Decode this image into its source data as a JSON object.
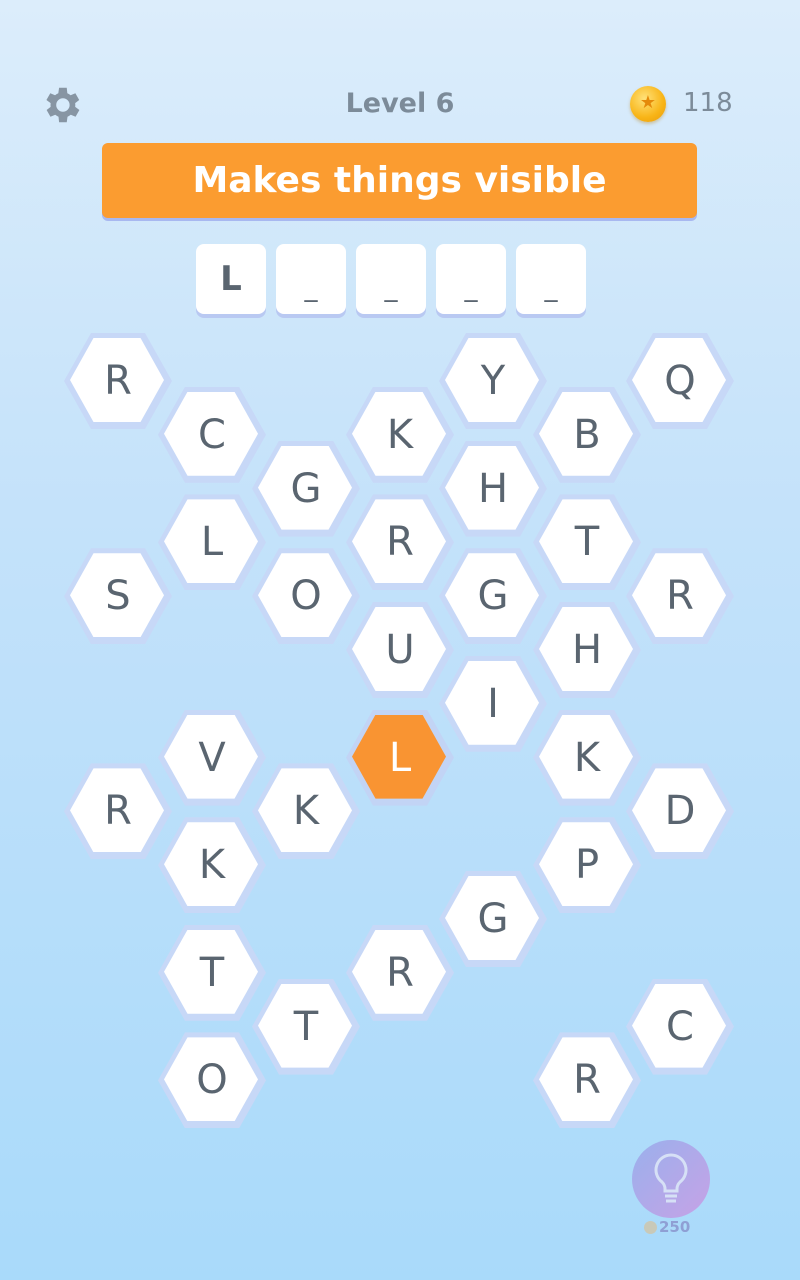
{
  "header": {
    "level": "Level 6",
    "coins": "118",
    "coin_icon": "coin-icon",
    "settings_icon": "gear-icon"
  },
  "clue": "Makes things visible",
  "answer_slots": [
    "L",
    "_",
    "_",
    "_",
    "_"
  ],
  "selected_color": "#f99432",
  "tiles": [
    {
      "letter": "R",
      "col": 0,
      "row": 0
    },
    {
      "letter": "C",
      "col": 1,
      "row": 1
    },
    {
      "letter": "G",
      "col": 2,
      "row": 2
    },
    {
      "letter": "K",
      "col": 3,
      "row": 1
    },
    {
      "letter": "Y",
      "col": 4,
      "row": 0
    },
    {
      "letter": "B",
      "col": 5,
      "row": 1
    },
    {
      "letter": "Q",
      "col": 6,
      "row": 0
    },
    {
      "letter": "L",
      "col": 1,
      "row": 3
    },
    {
      "letter": "R",
      "col": 3,
      "row": 3
    },
    {
      "letter": "H",
      "col": 4,
      "row": 2
    },
    {
      "letter": "T",
      "col": 5,
      "row": 3
    },
    {
      "letter": "S",
      "col": 0,
      "row": 4
    },
    {
      "letter": "O",
      "col": 2,
      "row": 4
    },
    {
      "letter": "G",
      "col": 4,
      "row": 4
    },
    {
      "letter": "R",
      "col": 6,
      "row": 4
    },
    {
      "letter": "U",
      "col": 3,
      "row": 5
    },
    {
      "letter": "H",
      "col": 5,
      "row": 5
    },
    {
      "letter": "I",
      "col": 4,
      "row": 6
    },
    {
      "letter": "V",
      "col": 1,
      "row": 7
    },
    {
      "letter": "L",
      "col": 3,
      "row": 7,
      "selected": true
    },
    {
      "letter": "K",
      "col": 5,
      "row": 7
    },
    {
      "letter": "R",
      "col": 0,
      "row": 8
    },
    {
      "letter": "K",
      "col": 2,
      "row": 8
    },
    {
      "letter": "D",
      "col": 6,
      "row": 8
    },
    {
      "letter": "K",
      "col": 1,
      "row": 9
    },
    {
      "letter": "P",
      "col": 5,
      "row": 9
    },
    {
      "letter": "G",
      "col": 4,
      "row": 10
    },
    {
      "letter": "T",
      "col": 1,
      "row": 11
    },
    {
      "letter": "R",
      "col": 3,
      "row": 11
    },
    {
      "letter": "T",
      "col": 2,
      "row": 12
    },
    {
      "letter": "C",
      "col": 6,
      "row": 12
    },
    {
      "letter": "O",
      "col": 1,
      "row": 13
    },
    {
      "letter": "R",
      "col": 5,
      "row": 13
    }
  ],
  "hint": {
    "icon": "lightbulb-icon",
    "cost": "250"
  }
}
